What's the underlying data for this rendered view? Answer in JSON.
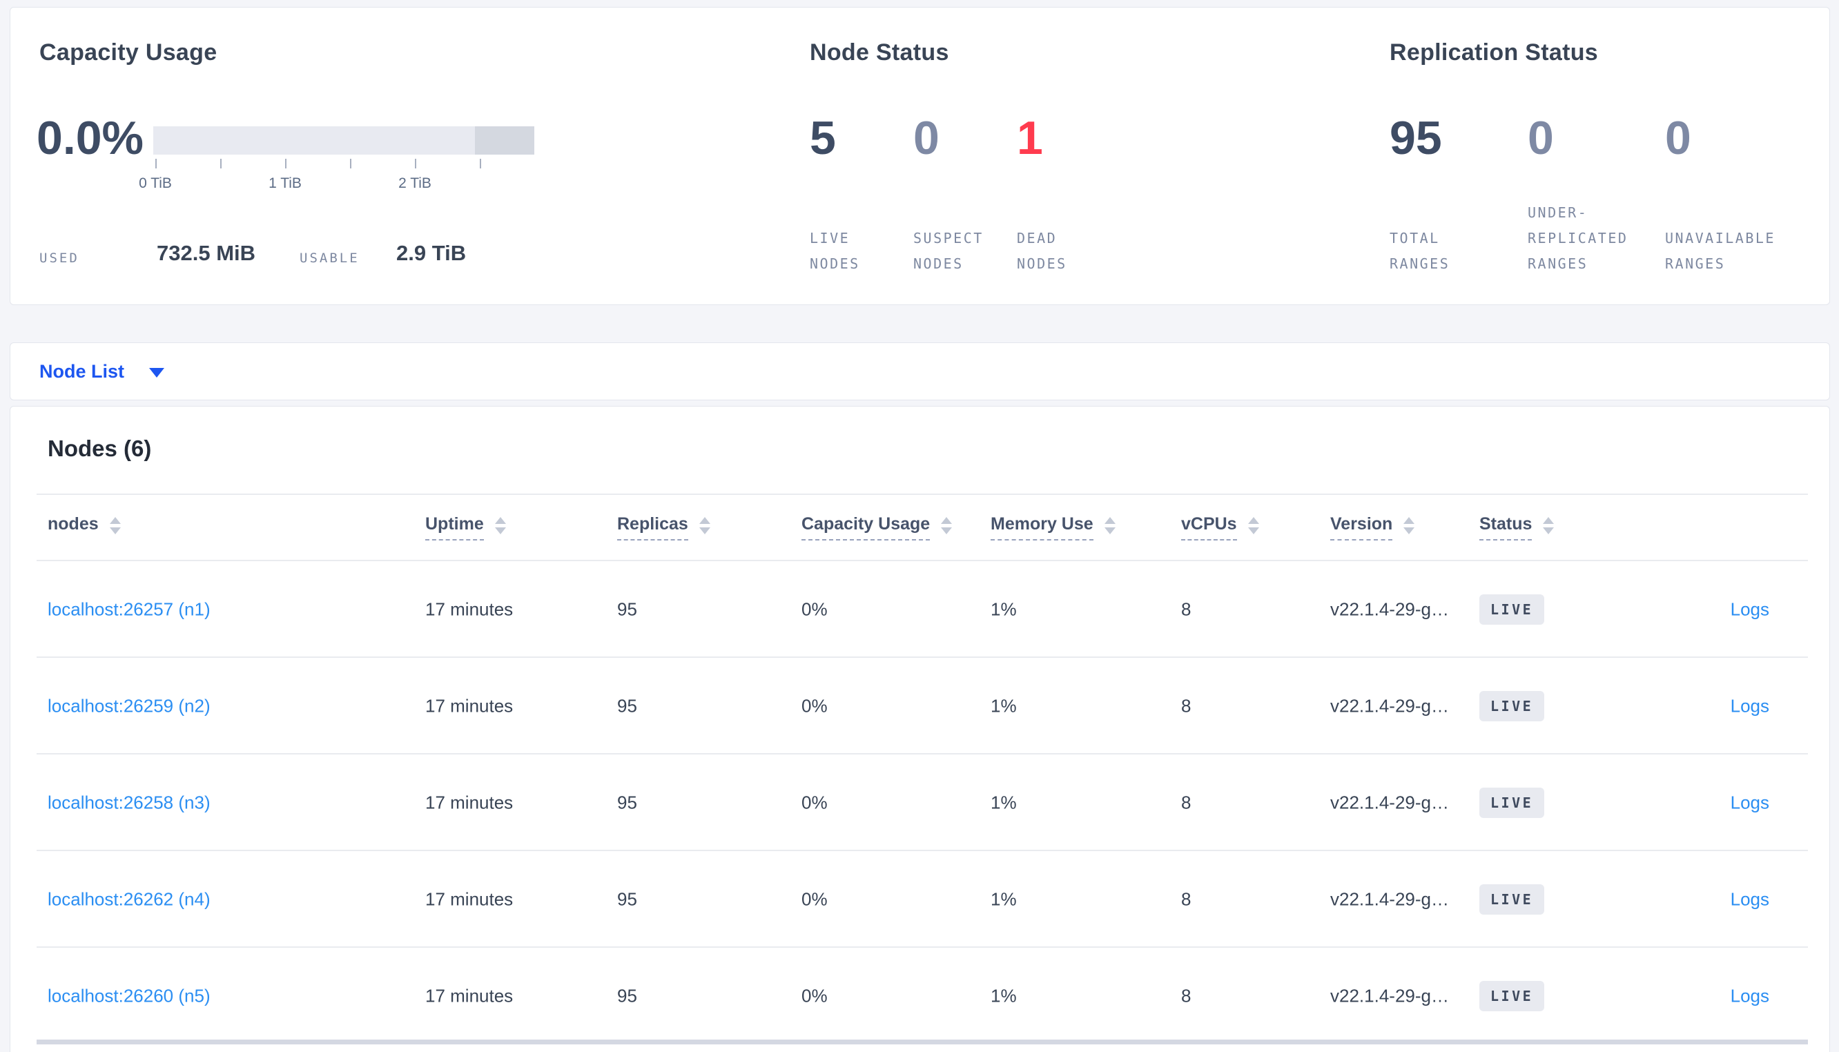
{
  "colors": {
    "page_bg": "#f4f5f9",
    "card_border": "#e3e6ed",
    "heading_text": "#394455",
    "value_text": "#394455",
    "muted_label": "#7d88a0",
    "stat_dark": "#3e4c64",
    "stat_light": "#7e89a4",
    "stat_red": "#ff3b4e",
    "dropdown_blue": "#1d56f0",
    "link_blue": "#2b8ef2",
    "bar_light": "#e8eaf1",
    "bar_dark": "#d4d8e0",
    "badge_bg": "#e8eaf0"
  },
  "capacity": {
    "title": "Capacity Usage",
    "percent_used": "0.0%",
    "used_label": "USED",
    "used_value": "732.5 MiB",
    "usable_label": "USABLE",
    "usable_value": "2.9 TiB",
    "bar": {
      "tick_count": 6,
      "tick_spacing_tib": 0.5,
      "segments": [
        {
          "name": "usable-capacity",
          "fraction": 0.844,
          "color": "#e8eaf1"
        },
        {
          "name": "other-usage",
          "fraction": 0.156,
          "color": "#d4d8e0"
        }
      ],
      "tick_labels": [
        {
          "text": "0 TiB",
          "tick": 0
        },
        {
          "text": "1 TiB",
          "tick": 2
        },
        {
          "text": "2 TiB",
          "tick": 4
        }
      ]
    }
  },
  "node_status": {
    "title": "Node Status",
    "stats": [
      {
        "value": "5",
        "label_lines": [
          "LIVE",
          "NODES"
        ],
        "color": "#3e4c64"
      },
      {
        "value": "0",
        "label_lines": [
          "SUSPECT",
          "NODES"
        ],
        "color": "#7e89a4"
      },
      {
        "value": "1",
        "label_lines": [
          "DEAD",
          "NODES"
        ],
        "color": "#ff3b4e"
      }
    ]
  },
  "replication_status": {
    "title": "Replication Status",
    "stats": [
      {
        "value": "95",
        "label_lines": [
          "TOTAL",
          "RANGES"
        ],
        "color": "#3e4c64"
      },
      {
        "value": "0",
        "label_lines": [
          "UNDER-",
          "REPLICATED",
          "RANGES"
        ],
        "color": "#7e89a4"
      },
      {
        "value": "0",
        "label_lines": [
          "UNAVAILABLE",
          "RANGES"
        ],
        "color": "#7e89a4"
      }
    ]
  },
  "node_list": {
    "label": "Node List"
  },
  "table": {
    "heading": "Nodes (6)",
    "columns": [
      {
        "key": "nodes",
        "label": "nodes",
        "dashed": false
      },
      {
        "key": "uptime",
        "label": "Uptime",
        "dashed": true
      },
      {
        "key": "replicas",
        "label": "Replicas",
        "dashed": true
      },
      {
        "key": "capacity",
        "label": "Capacity Usage",
        "dashed": true
      },
      {
        "key": "memory",
        "label": "Memory Use",
        "dashed": true
      },
      {
        "key": "vcpus",
        "label": "vCPUs",
        "dashed": true
      },
      {
        "key": "version",
        "label": "Version",
        "dashed": true
      },
      {
        "key": "status",
        "label": "Status",
        "dashed": true
      }
    ],
    "rows": [
      {
        "node": "localhost:26257 (n1)",
        "uptime": "17 minutes",
        "replicas": "95",
        "capacity": "0%",
        "memory": "1%",
        "vcpus": "8",
        "version": "v22.1.4-29-g…",
        "status": "LIVE",
        "logs": "Logs"
      },
      {
        "node": "localhost:26259 (n2)",
        "uptime": "17 minutes",
        "replicas": "95",
        "capacity": "0%",
        "memory": "1%",
        "vcpus": "8",
        "version": "v22.1.4-29-g…",
        "status": "LIVE",
        "logs": "Logs"
      },
      {
        "node": "localhost:26258 (n3)",
        "uptime": "17 minutes",
        "replicas": "95",
        "capacity": "0%",
        "memory": "1%",
        "vcpus": "8",
        "version": "v22.1.4-29-g…",
        "status": "LIVE",
        "logs": "Logs"
      },
      {
        "node": "localhost:26262 (n4)",
        "uptime": "17 minutes",
        "replicas": "95",
        "capacity": "0%",
        "memory": "1%",
        "vcpus": "8",
        "version": "v22.1.4-29-g…",
        "status": "LIVE",
        "logs": "Logs"
      },
      {
        "node": "localhost:26260 (n5)",
        "uptime": "17 minutes",
        "replicas": "95",
        "capacity": "0%",
        "memory": "1%",
        "vcpus": "8",
        "version": "v22.1.4-29-g…",
        "status": "LIVE",
        "logs": "Logs"
      }
    ]
  }
}
